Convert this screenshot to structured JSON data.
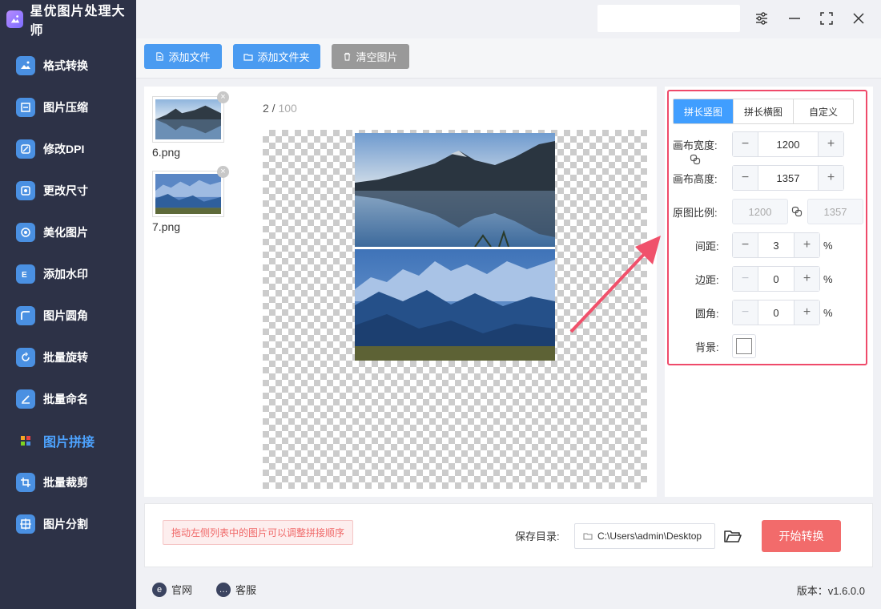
{
  "app": {
    "title": "星优图片处理大师",
    "accent": "#4a9bf1"
  },
  "sidebar": {
    "items": [
      {
        "label": "格式转换",
        "icon": "format-convert-icon"
      },
      {
        "label": "图片压缩",
        "icon": "compress-icon"
      },
      {
        "label": "修改DPI",
        "icon": "dpi-icon"
      },
      {
        "label": "更改尺寸",
        "icon": "resize-icon"
      },
      {
        "label": "美化图片",
        "icon": "beautify-icon"
      },
      {
        "label": "添加水印",
        "icon": "watermark-icon"
      },
      {
        "label": "图片圆角",
        "icon": "round-corner-icon"
      },
      {
        "label": "批量旋转",
        "icon": "rotate-icon"
      },
      {
        "label": "批量命名",
        "icon": "rename-icon"
      },
      {
        "label": "图片拼接",
        "icon": "stitch-icon",
        "active": true
      },
      {
        "label": "批量裁剪",
        "icon": "crop-icon"
      },
      {
        "label": "图片分割",
        "icon": "split-icon"
      }
    ]
  },
  "toolbar": {
    "add_file": "添加文件",
    "add_folder": "添加文件夹",
    "clear": "清空图片"
  },
  "files": [
    {
      "name": "6.png"
    },
    {
      "name": "7.png"
    }
  ],
  "preview": {
    "current": "2",
    "sep": " / ",
    "total": "100"
  },
  "settings": {
    "tabs": [
      "拼长竖图",
      "拼长横图",
      "自定义"
    ],
    "active_tab": 0,
    "canvas_width_label": "画布宽度:",
    "canvas_width": "1200",
    "canvas_height_label": "画布高度:",
    "canvas_height": "1357",
    "ratio_label": "原图比例:",
    "ratio_width": "1200",
    "ratio_height": "1357",
    "spacing_label": "间距:",
    "spacing": "3",
    "margin_label": "边距:",
    "margin": "0",
    "radius_label": "圆角:",
    "radius": "0",
    "pct": "%",
    "background_label": "背景:"
  },
  "bottom": {
    "hint": "拖动左侧列表中的图片可以调整拼接顺序",
    "save_label": "保存目录:",
    "save_path": "C:\\Users\\admin\\Desktop",
    "start": "开始转换"
  },
  "footer": {
    "website": "官网",
    "service": "客服",
    "version": "版本：v1.6.0.0"
  }
}
